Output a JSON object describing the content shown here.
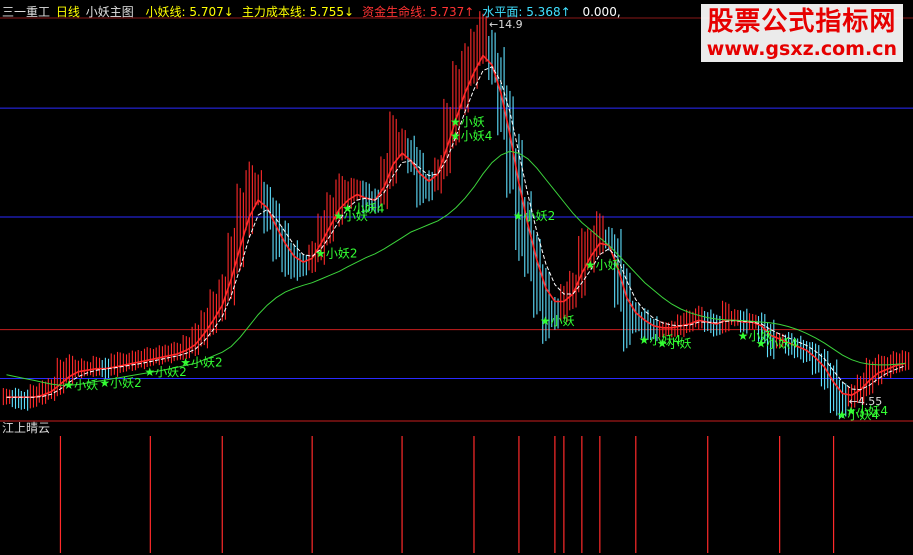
{
  "header": {
    "stock_name": "三一重工",
    "period": "日线",
    "indicator": "小妖主图",
    "lines": [
      {
        "label": "小妖线:",
        "value": "5.707",
        "arrow": "↓",
        "color": "#ffff00"
      },
      {
        "label": "主力成本线:",
        "value": "5.755",
        "arrow": "↓",
        "color": "#ffff00"
      },
      {
        "label": "资金生命线:",
        "value": "5.737",
        "arrow": "↑",
        "color": "#ff3333"
      },
      {
        "label": "水平面:",
        "value": "5.368",
        "arrow": "↑",
        "color": "#40e0ff"
      },
      {
        "label": "",
        "value": "0.000,",
        "arrow": "",
        "color": "#ffffff"
      }
    ]
  },
  "watermark": {
    "title": "股票公式指标网",
    "url": "www.gsxz.com.cn"
  },
  "sub_panel": {
    "title": "江上晴云"
  },
  "colors": {
    "up": "#ff2a2a",
    "down": "#5fe0ff",
    "ma_white": "#ffffff",
    "ma_red": "#ff2a2a",
    "ma_green": "#3cd43c",
    "hline": "#2a2aff",
    "signal": "#33ff33"
  },
  "chart_data": [
    {
      "type": "candlestick",
      "title": "三一重工 日线 小妖主图",
      "ylim": [
        4.3,
        14.9
      ],
      "max_label": "14.9",
      "min_label": "4.55",
      "price": [
        4.8,
        4.75,
        4.7,
        4.8,
        4.9,
        5,
        5.3,
        5.5,
        5.55,
        5.55,
        5.6,
        5.55,
        5.65,
        5.7,
        5.75,
        5.8,
        5.85,
        5.9,
        5.95,
        6,
        6.1,
        6.3,
        6.6,
        7,
        7.4,
        8.2,
        9.2,
        10,
        10.3,
        9.8,
        9.2,
        8.7,
        8.4,
        8.3,
        8.5,
        9,
        9.5,
        10,
        10.2,
        10.3,
        10.1,
        10,
        10.5,
        11.3,
        11.5,
        11.2,
        10.6,
        10.4,
        10.7,
        11.6,
        12.5,
        13.2,
        13.8,
        14.3,
        13.8,
        12.8,
        11.5,
        10,
        9,
        8,
        7.2,
        7,
        7.3,
        7.6,
        8.3,
        8.7,
        9.1,
        9,
        8.1,
        7.1,
        6.9,
        6.7,
        6.6,
        6.6,
        6.6,
        6.7,
        6.8,
        6.9,
        6.8,
        6.7,
        6.9,
        6.9,
        6.8,
        6.8,
        6.6,
        6.3,
        6.3,
        6.2,
        6.1,
        6,
        5.8,
        5.5,
        5,
        4.7,
        4.8,
        5,
        5.3,
        5.5,
        5.6,
        5.7,
        5.75
      ],
      "series": [
        {
          "values": [
            4.8,
            4.8,
            4.8,
            4.8,
            4.85,
            4.95,
            5.15,
            5.35,
            5.48,
            5.52,
            5.56,
            5.56,
            5.6,
            5.65,
            5.7,
            5.75,
            5.8,
            5.85,
            5.9,
            5.95,
            6.05,
            6.2,
            6.5,
            6.85,
            7.25,
            7.95,
            8.8,
            9.6,
            10.05,
            9.85,
            9.35,
            8.9,
            8.55,
            8.4,
            8.5,
            8.9,
            9.35,
            9.8,
            10.05,
            10.2,
            10.1,
            10.05,
            10.4,
            11,
            11.3,
            11.1,
            10.75,
            10.55,
            10.75,
            11.45,
            12.2,
            12.9,
            13.45,
            13.9,
            13.65,
            12.9,
            11.8,
            10.5,
            9.4,
            8.45,
            7.7,
            7.35,
            7.35,
            7.55,
            8.1,
            8.55,
            8.9,
            8.85,
            8.25,
            7.45,
            7.05,
            6.85,
            6.7,
            6.65,
            6.65,
            6.7,
            6.75,
            6.85,
            6.8,
            6.75,
            6.85,
            6.85,
            6.8,
            6.8,
            6.7,
            6.45,
            6.35,
            6.25,
            6.15,
            6.05,
            5.85,
            5.6,
            5.2,
            4.9,
            4.85,
            5,
            5.25,
            5.45,
            5.55,
            5.65,
            5.7
          ]
        },
        {
          "values": [
            4.8,
            4.8,
            4.8,
            4.8,
            4.82,
            4.88,
            5.02,
            5.2,
            5.35,
            5.45,
            5.52,
            5.55,
            5.58,
            5.62,
            5.66,
            5.7,
            5.75,
            5.8,
            5.85,
            5.9,
            5.97,
            6.08,
            6.3,
            6.6,
            6.95,
            7.5,
            8.25,
            9.05,
            9.65,
            9.8,
            9.55,
            9.2,
            8.85,
            8.6,
            8.55,
            8.75,
            9.1,
            9.5,
            9.85,
            10.05,
            10.1,
            10.05,
            10.25,
            10.7,
            11.05,
            11.1,
            10.9,
            10.7,
            10.75,
            11.15,
            11.75,
            12.4,
            13,
            13.5,
            13.6,
            13.2,
            12.4,
            11.3,
            10.2,
            9.2,
            8.35,
            7.8,
            7.55,
            7.55,
            7.85,
            8.2,
            8.6,
            8.75,
            8.5,
            7.9,
            7.4,
            7.1,
            6.9,
            6.78,
            6.72,
            6.7,
            6.72,
            6.8,
            6.8,
            6.78,
            6.82,
            6.84,
            6.82,
            6.8,
            6.75,
            6.6,
            6.48,
            6.38,
            6.28,
            6.18,
            6.02,
            5.82,
            5.5,
            5.2,
            5.02,
            5,
            5.12,
            5.3,
            5.45,
            5.55,
            5.64
          ]
        },
        {
          "values": [
            5.4,
            5.35,
            5.3,
            5.25,
            5.2,
            5.15,
            5.12,
            5.12,
            5.14,
            5.18,
            5.22,
            5.26,
            5.3,
            5.34,
            5.38,
            5.42,
            5.46,
            5.5,
            5.55,
            5.6,
            5.65,
            5.7,
            5.8,
            5.9,
            6,
            6.15,
            6.4,
            6.7,
            7,
            7.25,
            7.45,
            7.6,
            7.7,
            7.78,
            7.85,
            7.95,
            8.05,
            8.15,
            8.28,
            8.4,
            8.52,
            8.62,
            8.75,
            8.9,
            9.05,
            9.2,
            9.3,
            9.4,
            9.5,
            9.65,
            9.85,
            10.1,
            10.4,
            10.75,
            11.05,
            11.25,
            11.35,
            11.3,
            11.15,
            10.9,
            10.6,
            10.3,
            10,
            9.7,
            9.45,
            9.25,
            9.05,
            8.85,
            8.6,
            8.35,
            8.1,
            7.85,
            7.65,
            7.45,
            7.28,
            7.15,
            7.05,
            6.98,
            6.92,
            6.88,
            6.86,
            6.85,
            6.84,
            6.82,
            6.8,
            6.78,
            6.74,
            6.68,
            6.6,
            6.5,
            6.38,
            6.24,
            6.08,
            5.92,
            5.8,
            5.72,
            5.68,
            5.66,
            5.66,
            5.68,
            5.7
          ]
        }
      ],
      "hlines": [
        5.3,
        6.6,
        9.6,
        12.5
      ],
      "annotations": [
        {
          "i": 7,
          "text": "小妖"
        },
        {
          "i": 11,
          "text": "小妖2"
        },
        {
          "i": 16,
          "text": "小妖2"
        },
        {
          "i": 20,
          "text": "小妖2"
        },
        {
          "i": 35,
          "text": "小妖2"
        },
        {
          "i": 37,
          "text": "小妖"
        },
        {
          "i": 38,
          "text": "小妖4"
        },
        {
          "i": 50,
          "text": "小妖"
        },
        {
          "i": 50,
          "text": "小妖4"
        },
        {
          "i": 57,
          "text": "小妖2"
        },
        {
          "i": 60,
          "text": "小妖"
        },
        {
          "i": 65,
          "text": "小妖"
        },
        {
          "i": 71,
          "text": "小妖4"
        },
        {
          "i": 73,
          "text": "小妖"
        },
        {
          "i": 82,
          "text": "小妖"
        },
        {
          "i": 84,
          "text": "小妖4"
        },
        {
          "i": 93,
          "text": "小妖4"
        },
        {
          "i": 94,
          "text": "小妖4"
        }
      ]
    },
    {
      "type": "bar",
      "title": "江上晴云",
      "signal_indices": [
        6,
        16,
        24,
        34,
        44,
        52,
        57,
        61,
        62,
        64,
        66,
        70,
        78,
        86,
        92
      ]
    }
  ]
}
